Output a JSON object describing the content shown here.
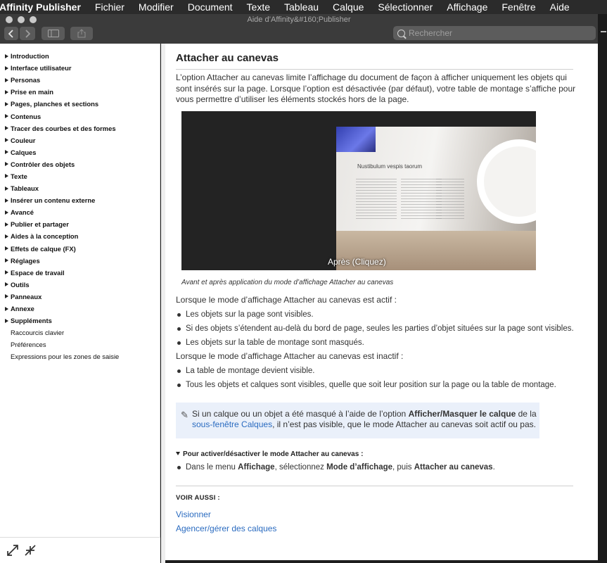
{
  "menubar": {
    "app": "Affinity Publisher",
    "items": [
      "Fichier",
      "Modifier",
      "Document",
      "Texte",
      "Tableau",
      "Calque",
      "Sélectionner",
      "Affichage",
      "Fenêtre",
      "Aide"
    ]
  },
  "window": {
    "title": "Aide d’Affinity&#160;Publisher"
  },
  "toolbar": {
    "search_placeholder": "Rechercher"
  },
  "sidebar": {
    "items": [
      "Introduction",
      "Interface utilisateur",
      "Personas",
      "Prise en main",
      "Pages, planches et sections",
      "Contenus",
      "Tracer des courbes et des formes",
      "Couleur",
      "Calques",
      "Contrôler des objets",
      "Texte",
      "Tableaux",
      "Insérer un contenu externe",
      "Avancé",
      "Publier et partager",
      "Aides à la conception",
      "Effets de calque (FX)",
      "Réglages",
      "Espace de travail",
      "Outils",
      "Panneaux",
      "Annexe",
      "Suppléments"
    ],
    "plain_items": [
      "Raccourcis clavier",
      "Préférences",
      "Expressions pour les zones de saisie"
    ]
  },
  "article": {
    "title": "Attacher au canevas",
    "intro": "L’option Attacher au canevas limite l’affichage du document de façon à afficher uniquement les objets qui sont insérés sur la page. Lorsque l’option est désactivée (par défaut), votre table de montage s’affiche pour vous permettre d’utiliser les éléments stockés hors de la page.",
    "figure": {
      "doc_title": "Nustibulum vespis taorum",
      "overlay": "Après (Cliquez)",
      "caption": "Avant et après application du mode d’affichage Attacher au canevas"
    },
    "active_heading": "Lorsque le mode d’affichage Attacher au canevas est actif :",
    "active_items": [
      "Les objets sur la page sont visibles.",
      "Si des objets s’étendent au-delà du bord de page, seules les parties d’objet situées sur la page sont visibles.",
      "Les objets sur la table de montage sont masqués."
    ],
    "inactive_heading": "Lorsque le mode d’affichage Attacher au canevas est inactif :",
    "inactive_items": [
      "La table de montage devient visible.",
      "Tous les objets et calques sont visibles, quelle que soit leur position sur la page ou la table de montage."
    ],
    "note": {
      "part1": "Si un calque ou un objet a été masqué à l’aide de l’option ",
      "bold": "Afficher/Masquer le calque",
      "part2": " de la ",
      "link": "sous-fenêtre Calques",
      "part3": ", il n’est pas visible, que le mode Attacher au canevas soit actif ou pas."
    },
    "toggle": {
      "label": "Pour activer/désactiver le mode Attacher au canevas :",
      "step_part1": "Dans le menu ",
      "step_b1": "Affichage",
      "step_part2": ", sélectionnez ",
      "step_b2": "Mode d’affichage",
      "step_part3": ", puis ",
      "step_b3": "Attacher au canevas",
      "step_part4": "."
    },
    "see_also": {
      "label": "VOIR AUSSI :",
      "links": [
        "Visionner",
        "Agencer/gérer des calques"
      ]
    }
  }
}
